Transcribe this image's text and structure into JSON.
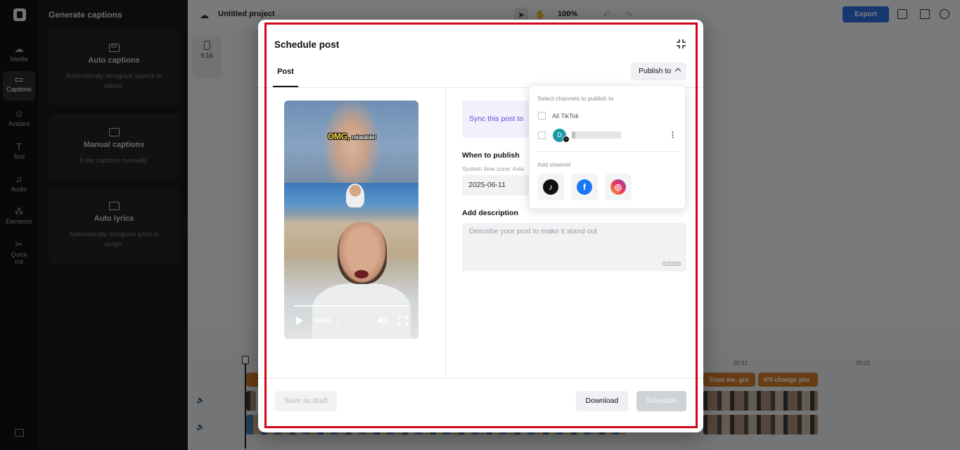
{
  "app": {
    "project_title": "Untitled project",
    "zoom": "100%",
    "export_label": "Export",
    "aspect_ratio": "9:16"
  },
  "rail": {
    "items": [
      {
        "label": "Media",
        "icon": "cloud-upload-icon"
      },
      {
        "label": "Captions",
        "icon": "captions-icon",
        "active": true
      },
      {
        "label": "Avatars",
        "icon": "avatar-icon"
      },
      {
        "label": "Text",
        "icon": "text-icon"
      },
      {
        "label": "Audio",
        "icon": "music-note-icon"
      },
      {
        "label": "Elements",
        "icon": "elements-icon"
      },
      {
        "label": "Quick",
        "label2": "cut",
        "icon": "quick-cut-icon"
      }
    ]
  },
  "side_panel": {
    "title": "Generate captions",
    "cards": [
      {
        "title": "Auto captions",
        "desc": "Automatically recognize speech in videos.",
        "icon": "cc-icon"
      },
      {
        "title": "Manual captions",
        "desc": "Enter captions manually.",
        "icon": "keyboard-icon"
      },
      {
        "title": "Auto lyrics",
        "desc": "Automatically recognize lyrics in songs.",
        "icon": "lyrics-icon"
      }
    ]
  },
  "timeline": {
    "ruler": [
      "00:12",
      "00:15"
    ],
    "clips": [
      "Trust me, gra",
      "It'll change you"
    ]
  },
  "modal": {
    "title": "Schedule post",
    "tab_post": "Post",
    "publish_to_label": "Publish to",
    "video": {
      "overlay_text_big": "OMG,",
      "overlay_text_small": "relatable!",
      "time_current": "00:00",
      "time_separator": "|",
      "time_total": "00:14"
    },
    "sync_text": "Sync this post to",
    "when_label": "When to publish",
    "timezone_label": "System time zone: Asia",
    "date_value": "2025-06-11",
    "desc_label": "Add description",
    "desc_placeholder": "Describe your post to make it stand out",
    "desc_count": "0/2200",
    "save_draft_label": "Save as draft",
    "download_label": "Download",
    "schedule_label": "Schedule"
  },
  "dropdown": {
    "title": "Select channels to publish to",
    "all_tiktok": "All TikTok",
    "account_initial": "D",
    "add_channel_label": "Add channel",
    "channels": [
      "tiktok-icon",
      "facebook-icon",
      "instagram-icon"
    ]
  },
  "colors": {
    "accent": "#2f6fe0",
    "sync_text": "#5c4bd6",
    "highlight_frame": "#d3051a",
    "clip_orange": "#d07a2b"
  }
}
